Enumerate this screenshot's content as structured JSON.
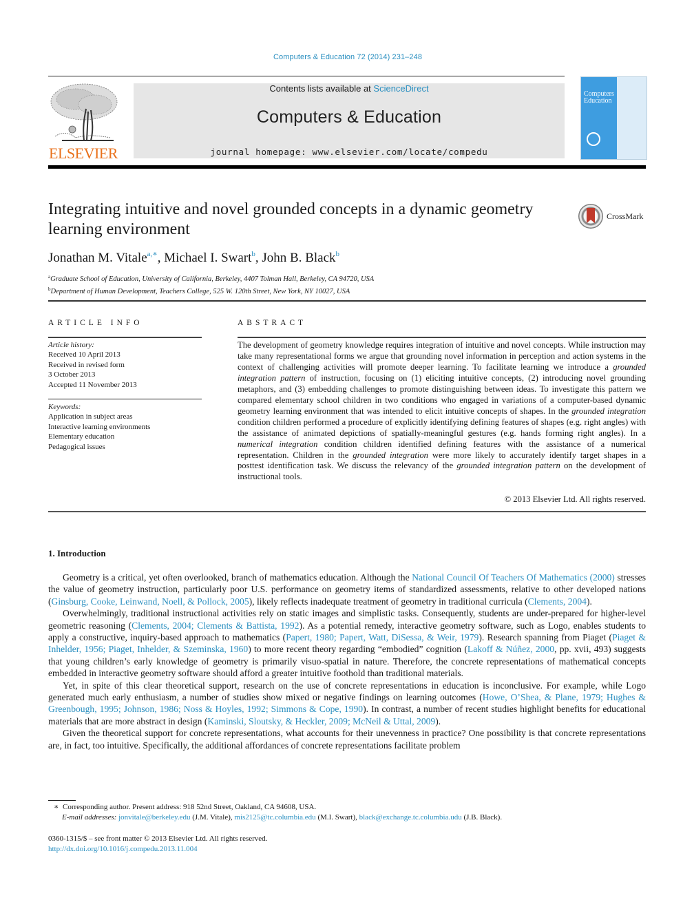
{
  "header": {
    "journal_ref": "Computers & Education 72 (2014) 231–248",
    "publisher_logo": "ELSEVIER",
    "contents_prefix": "Contents lists available at ",
    "contents_link": "ScienceDirect",
    "journal_title": "Computers & Education",
    "homepage": "journal homepage: www.elsevier.com/locate/compedu",
    "cover": {
      "line1": "Computers",
      "line2": "&",
      "line3": "Education"
    },
    "crossmark_label": "CrossMark",
    "colors": {
      "link": "#2a8fc0",
      "elsevier_orange": "#e9711c",
      "banner_bg": "#e6e6e6",
      "cover_blue": "#3e9de0"
    }
  },
  "article": {
    "title": "Integrating intuitive and novel grounded concepts in a dynamic geometry learning environment",
    "authors": [
      {
        "name": "Jonathan M. Vitale",
        "sup": "a,∗"
      },
      {
        "name": "Michael I. Swart",
        "sup": "b"
      },
      {
        "name": "John B. Black",
        "sup": "b"
      }
    ],
    "affiliations": [
      {
        "sup": "a",
        "text": "Graduate School of Education, University of California, Berkeley, 4407 Tolman Hall, Berkeley, CA 94720, USA"
      },
      {
        "sup": "b",
        "text": "Department of Human Development, Teachers College, 525 W. 120th Street, New York, NY 10027, USA"
      }
    ]
  },
  "article_info": {
    "heading": "ARTICLE INFO",
    "history_label": "Article history:",
    "history": [
      "Received 10 April 2013",
      "Received in revised form",
      "3 October 2013",
      "Accepted 11 November 2013"
    ],
    "keywords_label": "Keywords:",
    "keywords": [
      "Application in subject areas",
      "Interactive learning environments",
      "Elementary education",
      "Pedagogical issues"
    ]
  },
  "abstract": {
    "heading": "ABSTRACT",
    "segments": [
      {
        "t": "The development of geometry knowledge requires integration of intuitive and novel concepts. While instruction may take many representational forms we argue that grounding novel information in perception and action systems in the context of challenging activities will promote deeper learning. To facilitate learning we introduce a "
      },
      {
        "t": "grounded integration pattern",
        "i": true
      },
      {
        "t": " of instruction, focusing on (1) eliciting intuitive concepts, (2) introducing novel grounding metaphors, and (3) embedding challenges to promote distinguishing between ideas. To investigate this pattern we compared elementary school children in two conditions who engaged in variations of a computer-based dynamic geometry learning environment that was intended to elicit intuitive concepts of shapes. In the "
      },
      {
        "t": "grounded integration",
        "i": true
      },
      {
        "t": " condition children performed a procedure of explicitly identifying defining features of shapes (e.g. right angles) with the assistance of animated depictions of spatially-meaningful gestures (e.g. hands forming right angles). In a "
      },
      {
        "t": "numerical integration",
        "i": true
      },
      {
        "t": " condition children identified defining features with the assistance of a numerical representation. Children in the "
      },
      {
        "t": "grounded integration",
        "i": true
      },
      {
        "t": " were more likely to accurately identify target shapes in a posttest identification task. We discuss the relevancy of the "
      },
      {
        "t": "grounded integration pattern",
        "i": true
      },
      {
        "t": " on the development of instructional tools."
      }
    ],
    "copyright": "© 2013 Elsevier Ltd. All rights reserved."
  },
  "body": {
    "section_heading": "1.  Introduction",
    "paragraphs": [
      [
        {
          "t": "Geometry is a critical, yet often overlooked, branch of mathematics education. Although the "
        },
        {
          "t": "National Council Of Teachers Of Mathematics (2000)",
          "l": true
        },
        {
          "t": " stresses the value of geometry instruction, particularly poor U.S. performance on geometry items of standardized assessments, relative to other developed nations ("
        },
        {
          "t": "Ginsburg, Cooke, Leinwand, Noell, & Pollock, 2005",
          "l": true
        },
        {
          "t": "), likely reflects inadequate treatment of geometry in traditional curricula ("
        },
        {
          "t": "Clements, 2004",
          "l": true
        },
        {
          "t": ")."
        }
      ],
      [
        {
          "t": "Overwhelmingly, traditional instructional activities rely on static images and simplistic tasks. Consequently, students are under-prepared for higher-level geometric reasoning ("
        },
        {
          "t": "Clements, 2004; Clements & Battista, 1992",
          "l": true
        },
        {
          "t": "). As a potential remedy, interactive geometry software, such as Logo, enables students to apply a constructive, inquiry-based approach to mathematics ("
        },
        {
          "t": "Papert, 1980; Papert, Watt, DiSessa, & Weir, 1979",
          "l": true
        },
        {
          "t": "). Research spanning from Piaget ("
        },
        {
          "t": "Piaget & Inhelder, 1956; Piaget, Inhelder, & Szeminska, 1960",
          "l": true
        },
        {
          "t": ") to more recent theory regarding “embodied” cognition ("
        },
        {
          "t": "Lakoff & Núñez, 2000",
          "l": true
        },
        {
          "t": ", pp. xvii, 493) suggests that young children’s early knowledge of geometry is primarily visuo-spatial in nature. Therefore, the concrete representations of mathematical concepts embedded in interactive geometry software should afford a greater intuitive foothold than traditional materials."
        }
      ],
      [
        {
          "t": "Yet, in spite of this clear theoretical support, research on the use of concrete representations in education is inconclusive. For example, while Logo generated much early enthusiasm, a number of studies show mixed or negative findings on learning outcomes ("
        },
        {
          "t": "Howe, O’Shea, & Plane, 1979; Hughes & Greenbough, 1995; Johnson, 1986; Noss & Hoyles, 1992; Simmons & Cope, 1990",
          "l": true
        },
        {
          "t": "). In contrast, a number of recent studies highlight benefits for educational materials that are more abstract in design ("
        },
        {
          "t": "Kaminski, Sloutsky, & Heckler, 2009; McNeil & Uttal, 2009",
          "l": true
        },
        {
          "t": ")."
        }
      ],
      [
        {
          "t": "Given the theoretical support for concrete representations, what accounts for their unevenness in practice? One possibility is that concrete representations are, in fact, too intuitive. Specifically, the additional affordances of concrete representations facilitate problem"
        }
      ]
    ]
  },
  "footnotes": {
    "corresponding_marker": "∗",
    "corresponding": "Corresponding author. Present address: 918 52nd Street, Oakland, CA 94608, USA.",
    "email_label": "E-mail addresses: ",
    "emails": [
      {
        "addr": "jonvitale@berkeley.edu",
        "who": " (J.M. Vitale), "
      },
      {
        "addr": "mis2125@tc.columbia.edu",
        "who": " (M.I. Swart), "
      },
      {
        "addr": "black@exchange.tc.columbia.udu",
        "who": " (J.B. Black)."
      }
    ],
    "front_matter": "0360-1315/$ – see front matter © 2013 Elsevier Ltd. All rights reserved.",
    "doi": "http://dx.doi.org/10.1016/j.compedu.2013.11.004"
  }
}
